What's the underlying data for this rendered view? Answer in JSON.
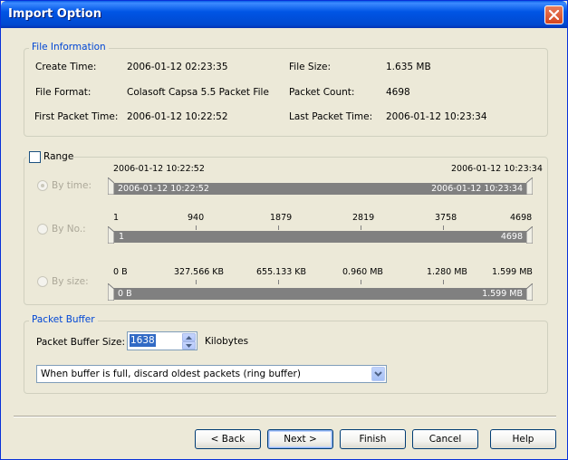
{
  "window": {
    "title": "Import Option"
  },
  "file_info": {
    "legend": "File Information",
    "create_time_label": "Create Time:",
    "create_time_value": "2006-01-12 02:23:35",
    "file_size_label": "File Size:",
    "file_size_value": "1.635 MB",
    "file_format_label": "File Format:",
    "file_format_value": "Colasoft Capsa 5.5 Packet File",
    "packet_count_label": "Packet Count:",
    "packet_count_value": "4698",
    "first_packet_label": "First Packet Time:",
    "first_packet_value": "2006-01-12 10:22:52",
    "last_packet_label": "Last Packet Time:",
    "last_packet_value": "2006-01-12 10:23:34"
  },
  "range": {
    "label": "Range",
    "checked": false,
    "by_time": {
      "label": "By time:",
      "selected": true,
      "top_left": "2006-01-12 10:22:52",
      "top_right": "2006-01-12 10:23:34",
      "track_left": "2006-01-12 10:22:52",
      "track_right": "2006-01-12 10:23:34"
    },
    "by_no": {
      "label": "By No.:",
      "selected": false,
      "ticks": [
        "1",
        "940",
        "1879",
        "2819",
        "3758",
        "4698"
      ],
      "track_left": "1",
      "track_right": "4698"
    },
    "by_size": {
      "label": "By size:",
      "selected": false,
      "ticks": [
        "0  B",
        "327.566 KB",
        "655.133 KB",
        "0.960 MB",
        "1.280 MB",
        "1.599 MB"
      ],
      "track_left": "0  B",
      "track_right": "1.599 MB"
    }
  },
  "packet_buffer": {
    "legend": "Packet Buffer",
    "size_label": "Packet Buffer Size:",
    "size_value": "1638",
    "unit": "Kilobytes",
    "policy_selected": "When buffer is full, discard oldest packets (ring buffer)"
  },
  "buttons": {
    "back": "< Back",
    "next": "Next >",
    "finish": "Finish",
    "cancel": "Cancel",
    "help": "Help"
  },
  "colors": {
    "title_bar": "#0055e5",
    "legend_text": "#0046d5",
    "track": "#808080",
    "disabled_text": "#aca899",
    "selection": "#316ac5",
    "close_button": "#d4451f"
  }
}
